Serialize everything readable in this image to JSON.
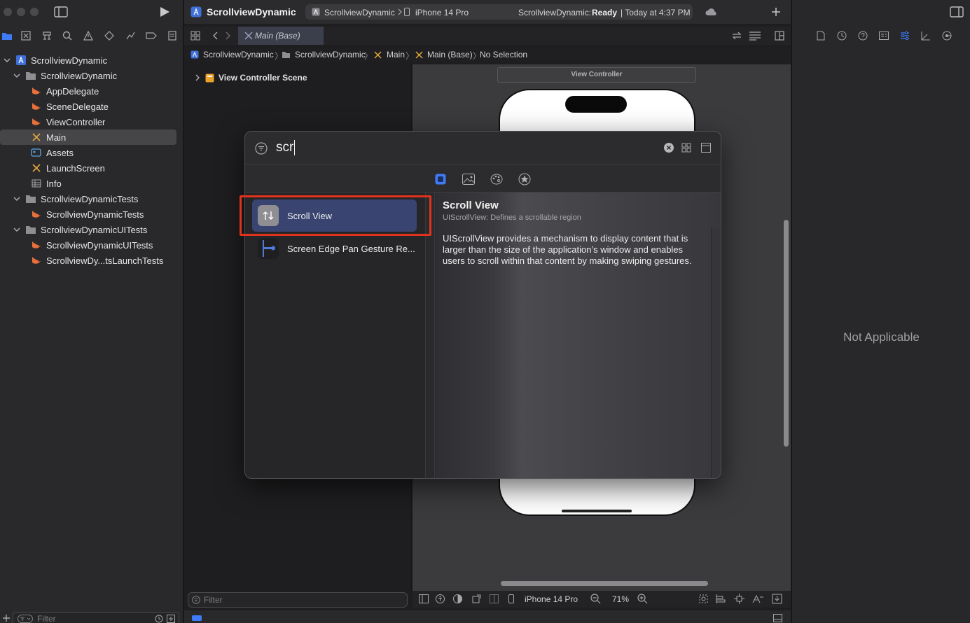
{
  "colors": {
    "accent": "#3d7bf7",
    "highlight": "#e0321c",
    "selected_row": "#394470",
    "swift_icon": "#e8703a",
    "storyboard_icon": "#e2a83a"
  },
  "toolbar": {
    "project_name": "ScrollviewDynamic",
    "scheme": "ScrollviewDynamic",
    "destination": "iPhone 14 Pro",
    "status_prefix": "ScrollviewDynamic:",
    "status_state": "Ready",
    "status_time": "| Today at 4:37 PM"
  },
  "tab": {
    "label": "Main (Base)"
  },
  "jumpbar": [
    "ScrollviewDynamic",
    "ScrollviewDynamic",
    "Main",
    "Main (Base)",
    "No Selection"
  ],
  "navigator": {
    "items": [
      {
        "label": "ScrollviewDynamic",
        "icon": "project-icon"
      },
      {
        "label": "ScrollviewDynamic",
        "icon": "folder-icon"
      },
      {
        "label": "AppDelegate",
        "icon": "swift-file-icon"
      },
      {
        "label": "SceneDelegate",
        "icon": "swift-file-icon"
      },
      {
        "label": "ViewController",
        "icon": "swift-file-icon"
      },
      {
        "label": "Main",
        "icon": "storyboard-icon"
      },
      {
        "label": "Assets",
        "icon": "asset-catalog-icon"
      },
      {
        "label": "LaunchScreen",
        "icon": "storyboard-icon"
      },
      {
        "label": "Info",
        "icon": "plist-icon"
      },
      {
        "label": "ScrollviewDynamicTests",
        "icon": "folder-icon"
      },
      {
        "label": "ScrollviewDynamicTests",
        "icon": "swift-file-icon"
      },
      {
        "label": "ScrollviewDynamicUITests",
        "icon": "folder-icon"
      },
      {
        "label": "ScrollviewDynamicUITests",
        "icon": "swift-file-icon"
      },
      {
        "label": "ScrollviewDy...tsLaunchTests",
        "icon": "swift-file-icon"
      }
    ],
    "filter_placeholder": "Filter"
  },
  "outline": {
    "scene_label": "View Controller Scene",
    "filter_placeholder": "Filter"
  },
  "canvas": {
    "scene_header": "View Controller",
    "device": "iPhone 14 Pro",
    "zoom": "71%"
  },
  "library": {
    "search_query": "scr",
    "categories": [
      "objects-icon",
      "media-icon",
      "colors-icon",
      "favorites-icon"
    ],
    "results": [
      {
        "label": "Scroll View",
        "icon": "scroll-view-icon"
      },
      {
        "label": "Screen Edge Pan Gesture Re...",
        "icon": "screen-edge-pan-icon"
      }
    ],
    "detail": {
      "title": "Scroll View",
      "subtitle": "UIScrollView: Defines a scrollable region",
      "description": "UIScrollView provides a mechanism to display content that is larger than the size of the application’s window and enables users to scroll within that content by making swiping gestures."
    }
  },
  "inspector": {
    "empty_label": "Not Applicable"
  }
}
